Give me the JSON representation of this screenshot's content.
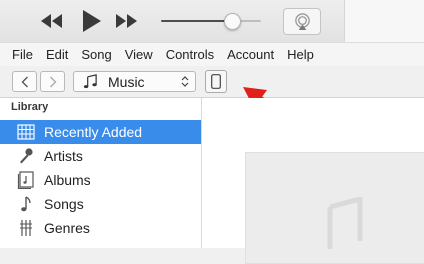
{
  "menu": {
    "items": [
      "File",
      "Edit",
      "Song",
      "View",
      "Controls",
      "Account",
      "Help"
    ]
  },
  "player": {
    "volume_level": 0.7
  },
  "nav": {
    "media_kind": "Music"
  },
  "sidebar": {
    "header": "Library",
    "items": [
      {
        "label": "Recently Added",
        "icon": "grid-icon",
        "selected": true
      },
      {
        "label": "Artists",
        "icon": "microphone-icon",
        "selected": false
      },
      {
        "label": "Albums",
        "icon": "album-icon",
        "selected": false
      },
      {
        "label": "Songs",
        "icon": "music-note-icon",
        "selected": false
      },
      {
        "label": "Genres",
        "icon": "guitar-icon",
        "selected": false
      }
    ]
  },
  "colors": {
    "selection": "#3a8cea",
    "annotation_arrow": "#e0201b"
  }
}
